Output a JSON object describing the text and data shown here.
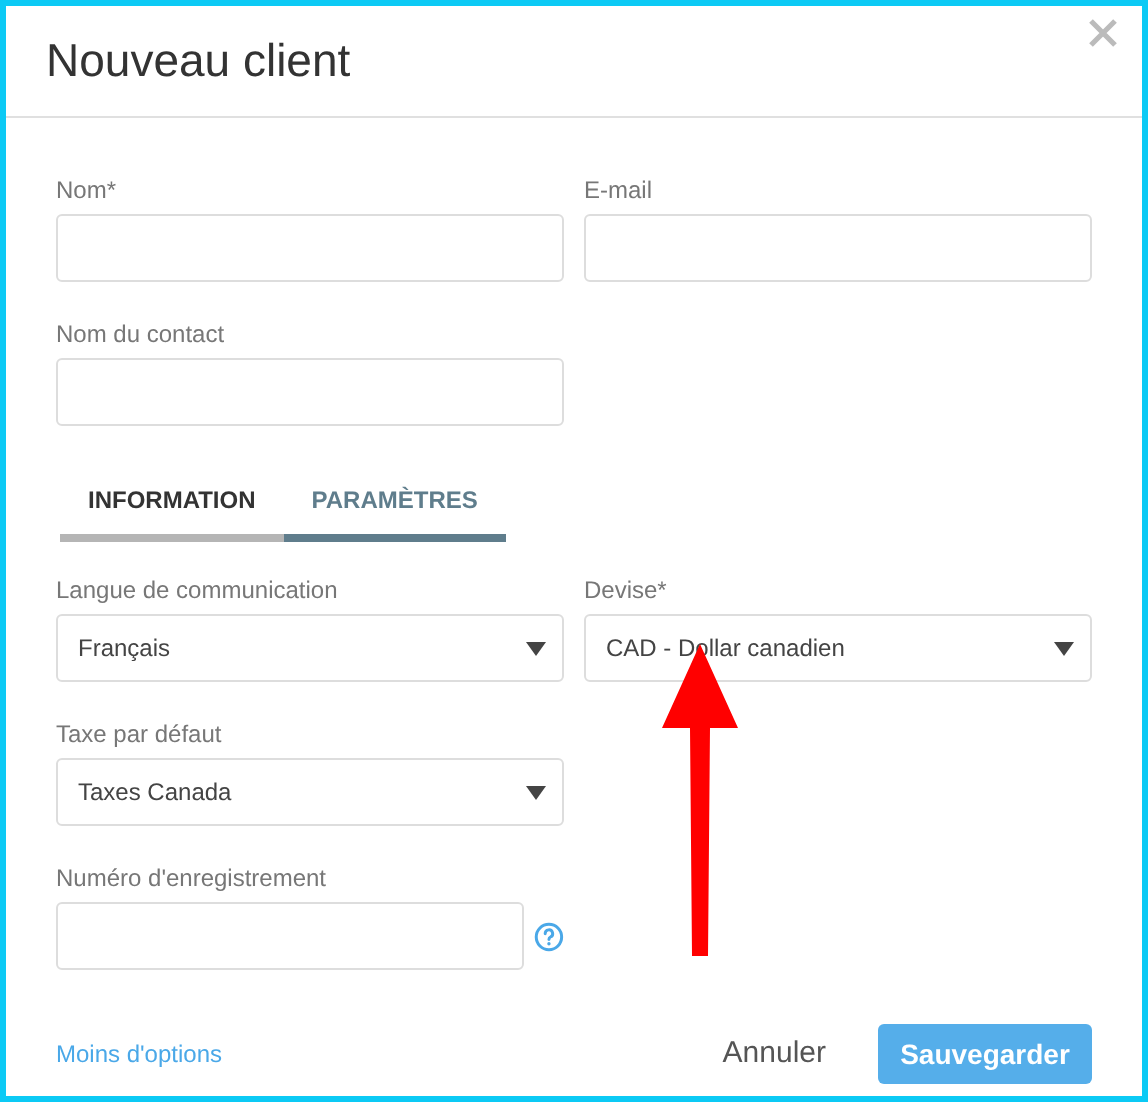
{
  "dialog": {
    "title": "Nouveau client"
  },
  "top_fields": [
    {
      "label": "Nom*",
      "kind": "text"
    },
    {
      "label": "E-mail",
      "kind": "text"
    },
    {
      "label": "Nom du contact",
      "kind": "text"
    }
  ],
  "tabs": [
    {
      "label": "INFORMATION",
      "selected": false
    },
    {
      "label": "PARAMÈTRES",
      "selected": true
    }
  ],
  "settings_fields": [
    {
      "label": "Langue de communication",
      "kind": "select",
      "value": "Français"
    },
    {
      "label": "Devise*",
      "kind": "select",
      "value": "CAD - Dollar canadien"
    },
    {
      "label": "Taxe par défaut",
      "kind": "select",
      "value": "Taxes Canada"
    },
    {
      "label": "Numéro d'enregistrement",
      "kind": "text",
      "help": true
    }
  ],
  "footer": {
    "link": "Moins d'options",
    "cancel": "Annuler",
    "save": "Sauvegarder"
  }
}
